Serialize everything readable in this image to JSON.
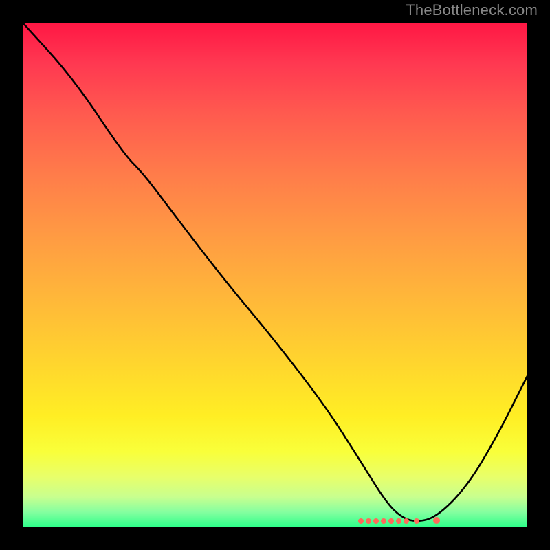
{
  "watermark": "TheBottleneck.com",
  "chart_data": {
    "type": "line",
    "title": "",
    "xlabel": "",
    "ylabel": "",
    "xlim": [
      0,
      100
    ],
    "ylim": [
      0,
      100
    ],
    "grid": false,
    "legend": false,
    "series": [
      {
        "name": "curve",
        "x": [
          0,
          10,
          20,
          24,
          30,
          40,
          50,
          60,
          67,
          72,
          75,
          78,
          82,
          88,
          94,
          100
        ],
        "values": [
          100,
          89,
          74,
          70,
          62,
          49,
          37,
          24,
          13,
          5,
          2,
          1,
          2,
          8,
          18,
          30
        ]
      }
    ],
    "markers": {
      "name": "optimum-dots",
      "x": [
        67,
        68.5,
        70,
        71.5,
        73,
        74.5,
        76,
        78,
        82
      ],
      "y": [
        1.2,
        1.2,
        1.2,
        1.2,
        1.2,
        1.2,
        1.2,
        1.2,
        1.4
      ]
    },
    "gradient_stops": [
      {
        "pos": 0,
        "color": "#ff1744"
      },
      {
        "pos": 50,
        "color": "#ffb63a"
      },
      {
        "pos": 80,
        "color": "#ffee24"
      },
      {
        "pos": 100,
        "color": "#2bff8a"
      }
    ]
  }
}
